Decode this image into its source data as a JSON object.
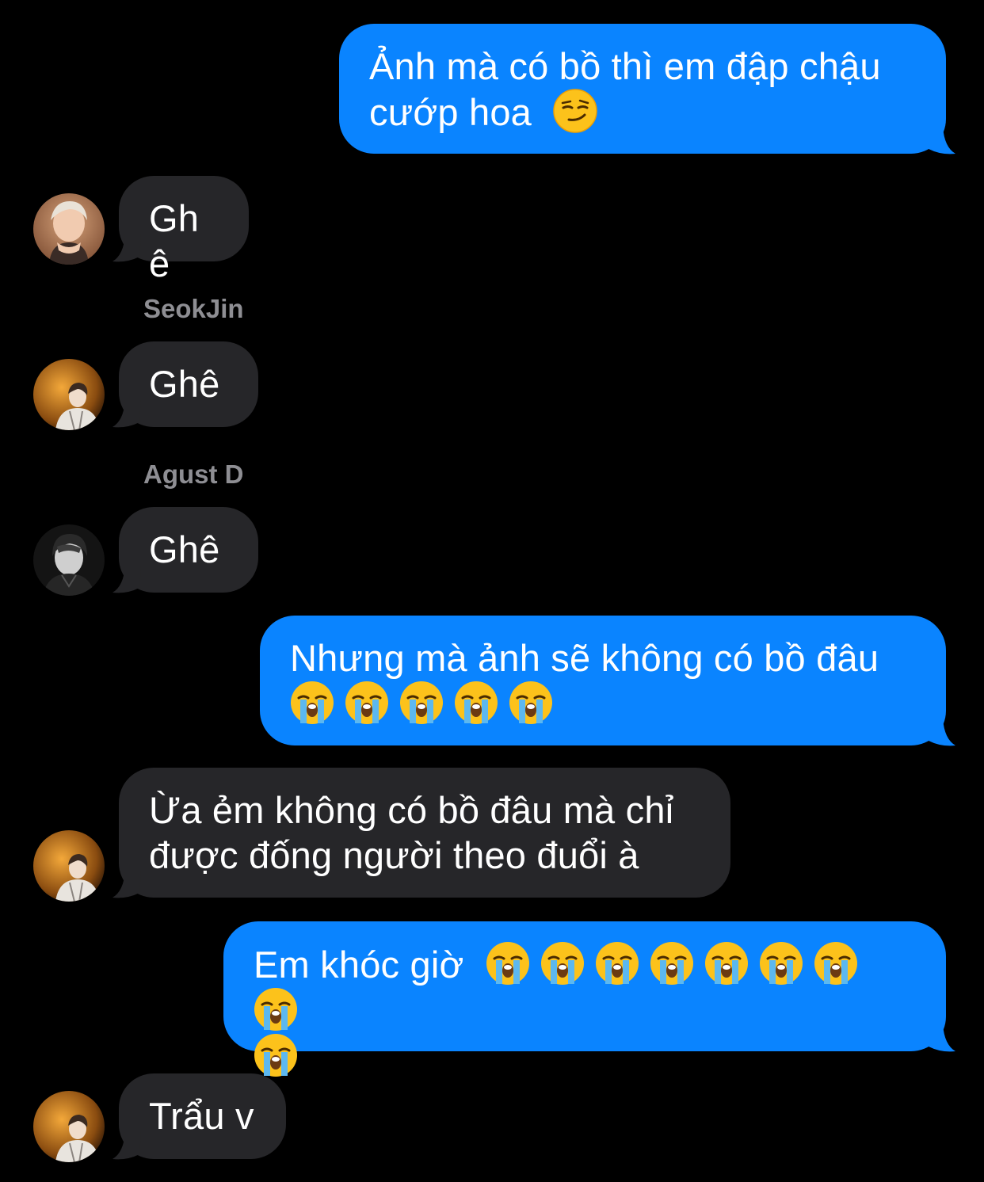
{
  "conversation": {
    "messages": [
      {
        "direction": "out",
        "text": "Ảnh mà có bồ thì em đập chậu cướp hoa",
        "emoji": [
          "smirk"
        ]
      },
      {
        "direction": "in",
        "sender": "",
        "text": "Ghê"
      },
      {
        "direction": "in",
        "sender": "SeokJin",
        "text": "Ghê"
      },
      {
        "direction": "in",
        "sender": "Agust D",
        "text": "Ghê"
      },
      {
        "direction": "out",
        "text": "Nhưng mà ảnh sẽ không có bồ đâu",
        "emoji": [
          "loudly-crying",
          "loudly-crying",
          "loudly-crying",
          "loudly-crying",
          "loudly-crying"
        ]
      },
      {
        "direction": "in",
        "sender": "",
        "text": "Ừa ẻm không có bồ đâu mà chỉ được đống người theo đuổi à"
      },
      {
        "direction": "out",
        "text": "Em khóc giờ",
        "emoji": [
          "loudly-crying",
          "loudly-crying",
          "loudly-crying",
          "loudly-crying",
          "loudly-crying",
          "loudly-crying",
          "loudly-crying",
          "loudly-crying",
          "loudly-crying"
        ]
      },
      {
        "direction": "in",
        "sender": "",
        "text": "Trẩu v"
      }
    ]
  },
  "colors": {
    "background": "#000000",
    "outgoing_bubble": "#0a84ff",
    "incoming_bubble": "#262629",
    "sender_name": "#8e8e93",
    "text": "#ffffff"
  }
}
